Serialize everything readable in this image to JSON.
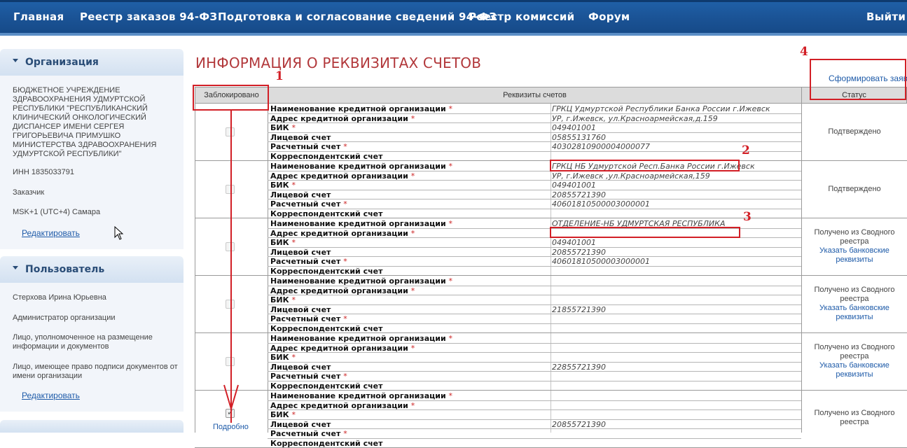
{
  "nav": {
    "items": [
      "Главная",
      "Реестр заказов 94-ФЗ",
      "Подготовка и согласование сведений 94-ФЗ",
      "Реестр комиссий",
      "Форум"
    ],
    "logout": "Выйти"
  },
  "org_panel": {
    "title": "Организация",
    "name": "БЮДЖЕТНОЕ УЧРЕЖДЕНИЕ ЗДРАВООХРАНЕНИЯ УДМУРТСКОЙ РЕСПУБЛИКИ \"РЕСПУБЛИКАНСКИЙ КЛИНИЧЕСКИЙ ОНКОЛОГИЧЕСКИЙ ДИСПАНСЕР ИМЕНИ СЕРГЕЯ ГРИГОРЬЕВИЧА ПРИМУШКО МИНИСТЕРСТВА ЗДРАВООХРАНЕНИЯ УДМУРТСКОЙ РЕСПУБЛИКИ\"",
    "inn": "ИНН 1835033791",
    "role": "Заказчик",
    "timezone": "MSK+1 (UTC+4) Самара",
    "edit": "Редактировать"
  },
  "user_panel": {
    "title": "Пользователь",
    "name": "Стерхова Ирина Юрьевна",
    "roles": [
      "Администратор организации",
      "Лицо, уполномоченное на размещение информации и документов",
      "Лицо, имеющее право подписи документов от имени организации"
    ],
    "edit": "Редактировать"
  },
  "page": {
    "title": "ИНФОРМАЦИЯ О РЕКВИЗИТАХ СЧЕТОВ",
    "form_link": "Сформировать заявк"
  },
  "table": {
    "headers": [
      "Заблокировано",
      "Реквизиты счетов",
      "Статус"
    ],
    "labels": [
      "Наименование кредитной организации",
      "Адрес кредитной организации",
      "БИК",
      "Лицевой счет",
      "Расчетный счет",
      "Корреспондентский счет"
    ],
    "req_mark": "*",
    "detail_link": "Подробно",
    "rows": [
      {
        "values": [
          "ГРКЦ Удмуртской Республики Банка России г.Ижевск",
          "УР, г.Ижевск, ул.Красноармейская,д.159",
          "049401001",
          "05855131760",
          "40302810900004000077",
          ""
        ],
        "status": "Подтверждено",
        "status_link": "",
        "checked": false
      },
      {
        "values": [
          "ГРКЦ НБ Удмуртской Респ.Банка России г.Ижевск",
          "УР, г.Ижевск ,ул.Красноармейская,159",
          "049401001",
          "20855721390",
          "40601810500003000001",
          ""
        ],
        "status": "Подтверждено",
        "status_link": "",
        "checked": false
      },
      {
        "values": [
          "ОТДЕЛЕНИЕ-НБ УДМУРТСКАЯ РЕСПУБЛИКА",
          "",
          "049401001",
          "20855721390",
          "40601810500003000001",
          ""
        ],
        "status": "Получено из Сводного реестра",
        "status_link": "Указать банковские реквизиты",
        "checked": false
      },
      {
        "values": [
          "",
          "",
          "",
          "21855721390",
          "",
          ""
        ],
        "status": "Получено из Сводного реестра",
        "status_link": "Указать банковские реквизиты",
        "checked": false
      },
      {
        "values": [
          "",
          "",
          "",
          "22855721390",
          "",
          ""
        ],
        "status": "Получено из Сводного реестра",
        "status_link": "Указать банковские реквизиты",
        "checked": false
      },
      {
        "values": [
          "",
          "",
          "",
          "20855721390",
          "",
          ""
        ],
        "status": "Получено из Сводного реестра",
        "status_link": "",
        "checked": true
      }
    ]
  },
  "annotations": {
    "numbers": [
      "1",
      "2",
      "3",
      "4"
    ],
    "color": "#d21f26"
  },
  "colors": {
    "nav_bg": "#1a5294",
    "title": "#b2383b",
    "link": "#1d5aa8"
  }
}
